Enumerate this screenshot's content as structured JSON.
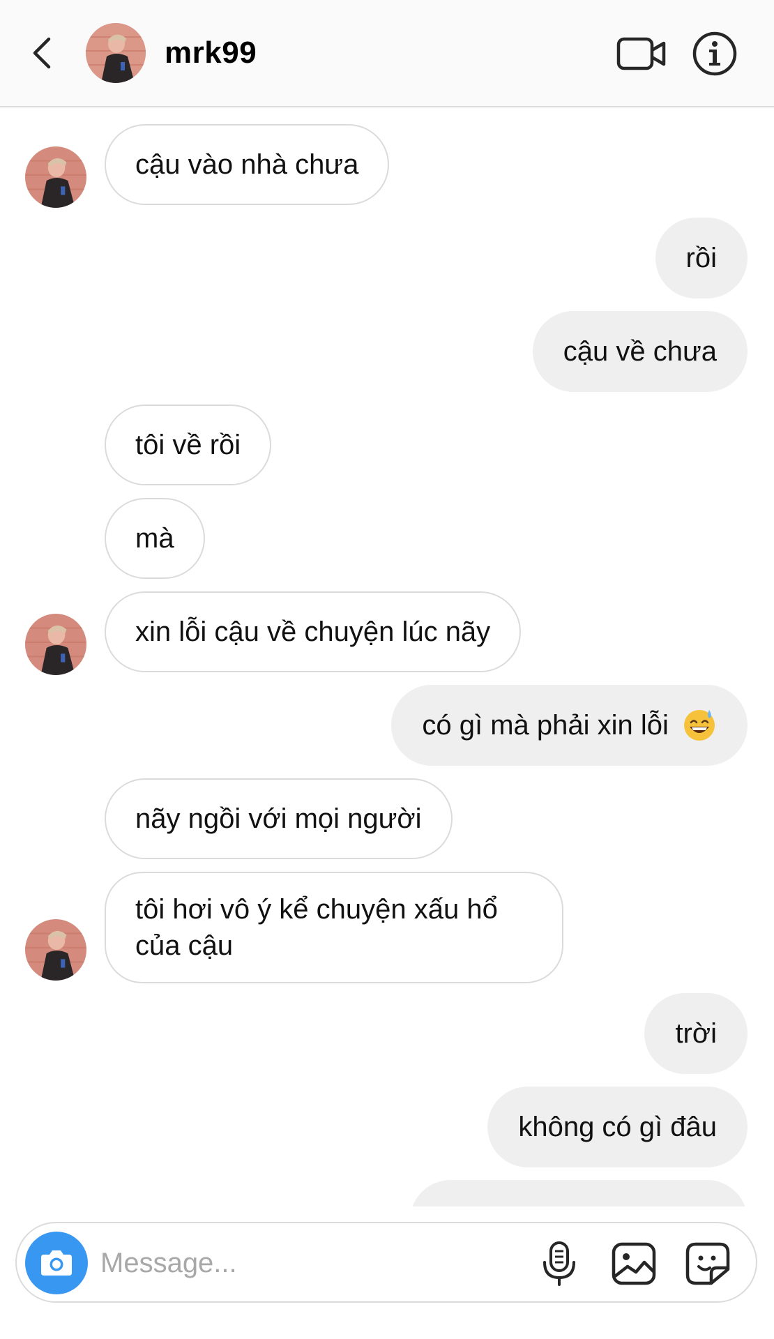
{
  "header": {
    "username": "mrk99",
    "back_icon": "chevron-left-icon",
    "video_icon": "video-camera-icon",
    "info_icon": "info-icon"
  },
  "messages": [
    {
      "side": "in",
      "text": "cậu vào nhà chưa",
      "avatar": true
    },
    {
      "side": "out",
      "text": "rồi"
    },
    {
      "side": "out",
      "text": "cậu về chưa"
    },
    {
      "side": "in",
      "text": "tôi về rồi"
    },
    {
      "side": "in",
      "text": "mà"
    },
    {
      "side": "in",
      "text": "xin lỗi cậu về chuyện lúc nãy",
      "avatar": true
    },
    {
      "side": "out",
      "text": "có gì mà phải xin lỗi",
      "emoji": "grinning-face-with-sweat-emoji"
    },
    {
      "side": "in",
      "text": "nãy ngồi với mọi người"
    },
    {
      "side": "in",
      "text": "tôi hơi vô ý kể chuyện xấu hổ của cậu",
      "avatar": true
    },
    {
      "side": "out",
      "text": "trời"
    },
    {
      "side": "out",
      "text": "không có gì đâu"
    }
  ],
  "composer": {
    "placeholder": "Message...",
    "camera_icon": "camera-icon",
    "mic_icon": "microphone-icon",
    "gallery_icon": "gallery-icon",
    "sticker_icon": "sticker-icon"
  },
  "colors": {
    "accent": "#3897f0",
    "incoming_bubble_border": "#dbdbdb",
    "outgoing_bubble_bg": "#efefef",
    "header_bg": "#fafafa"
  }
}
